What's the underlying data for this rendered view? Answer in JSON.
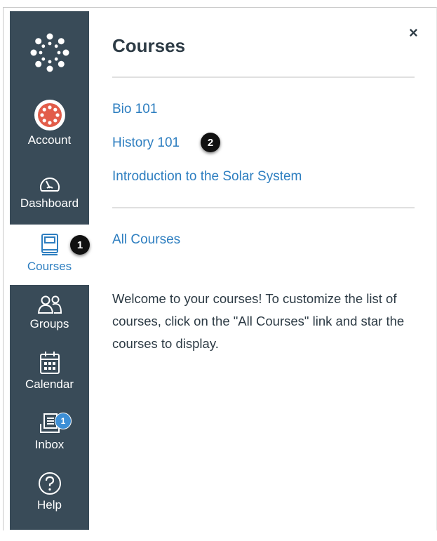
{
  "nav": {
    "logo_icon": "canvas-logo-icon",
    "items": [
      {
        "label": "Account",
        "icon": "account-avatar-icon"
      },
      {
        "label": "Dashboard",
        "icon": "dashboard-icon"
      },
      {
        "label": "Courses",
        "icon": "courses-book-icon",
        "active": true
      },
      {
        "label": "Groups",
        "icon": "groups-icon"
      },
      {
        "label": "Calendar",
        "icon": "calendar-icon"
      },
      {
        "label": "Inbox",
        "icon": "inbox-icon",
        "badge": "1"
      },
      {
        "label": "Help",
        "icon": "help-icon"
      }
    ]
  },
  "tray": {
    "title": "Courses",
    "close_label": "×",
    "courses": [
      "Bio 101",
      "History 101",
      "Introduction to the Solar System"
    ],
    "all_courses_label": "All Courses",
    "welcome_text": "Welcome to your courses! To customize the list of courses, click on the \"All Courses\" link and star the courses to display."
  },
  "callouts": [
    "1",
    "2"
  ],
  "colors": {
    "nav_bg": "#394b58",
    "link": "#2d7ec0",
    "active_label": "#2d7ec0",
    "badge": "#3d8fd6",
    "text": "#2d3b45"
  }
}
